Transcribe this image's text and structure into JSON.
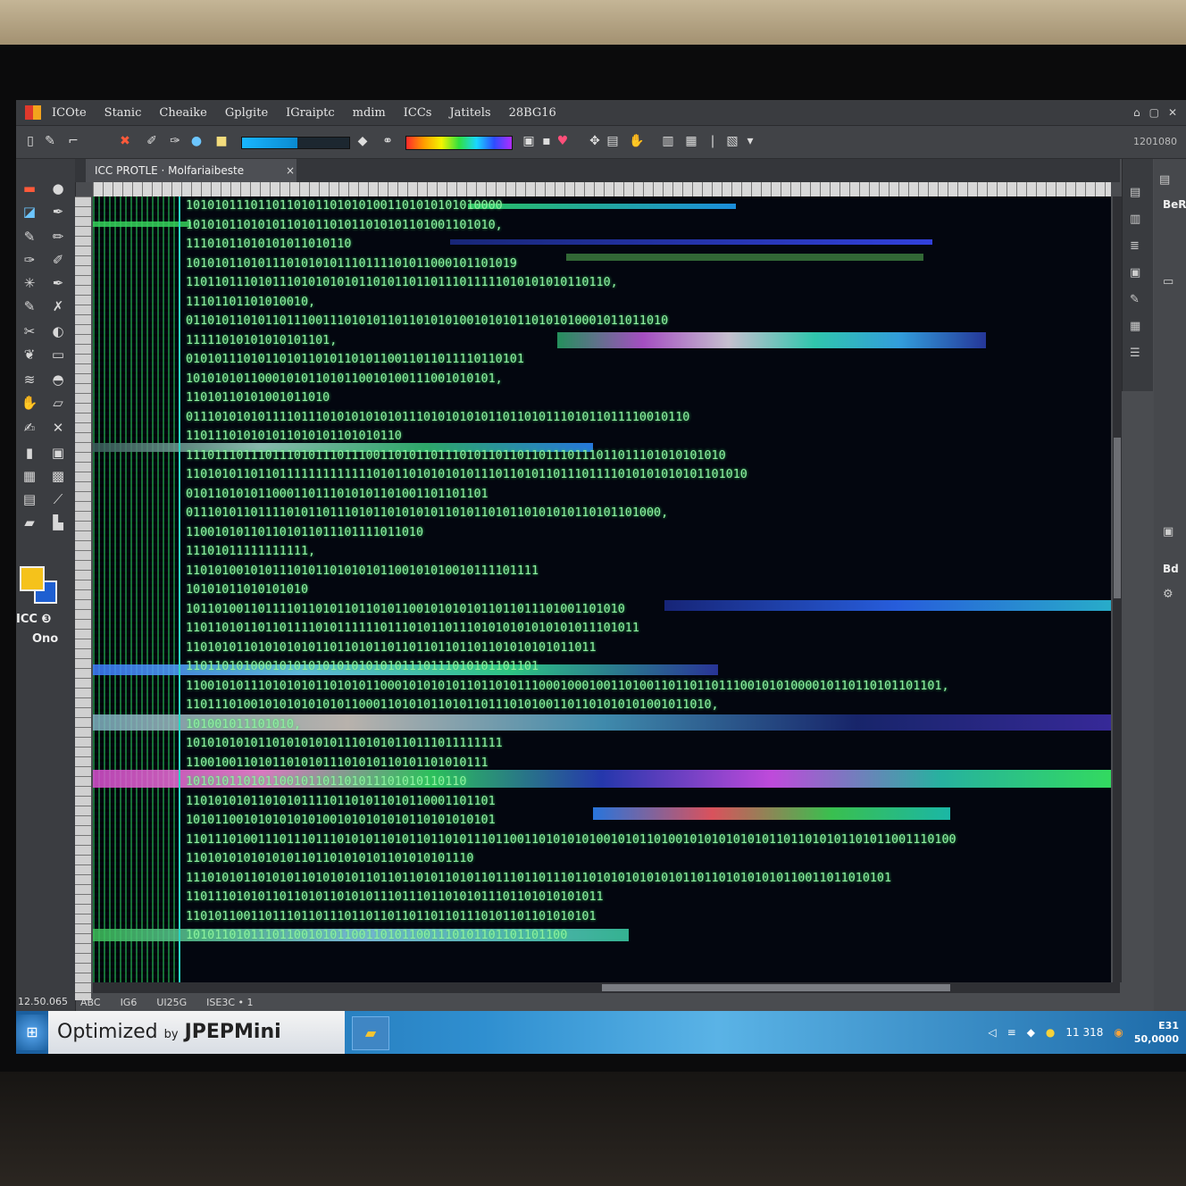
{
  "app": {
    "menu": [
      "ICOte",
      "Stanic",
      "Cheaike",
      "Gplgite",
      "IGraiptc",
      "mdim",
      "ICCs",
      "Jatitels",
      "28BG16"
    ]
  },
  "toolbar": {
    "progress_fraction": 0.52,
    "right_text": "1201080"
  },
  "document_tab": {
    "label": "ICC PROTLE · Molfariaibeste",
    "close_label": "×"
  },
  "tools_panel": {
    "label_line1": "ICC ❸",
    "label_line2": "Ono"
  },
  "right_panel": {
    "title1": "BeR",
    "title2": "Bd"
  },
  "canvas": {
    "code_lines": [
      "10101011101101101011010101001101010101010000",
      "1010101101010110101101011010101101001101010,",
      "11101011010101011010110",
      "1010101101011101010101110111101011000101101019",
      "11011011101011101010101011010110110111011111010101010110110,",
      "11101101101010010,",
      "0110101101011011100111010101101101010100101010110101010001011011010",
      "11111010101010101101,",
      "01010111010110101101011010110011011011110110101",
      "1010101011000101011010110010100111001010101,",
      "11010110101001011010",
      "0111010101011110111010101010101110101010101101101011101011011110010110",
      "110111010101011010101101010110",
      "111011101110111010111011100110101101110101101101101110111011011101010101010",
      "110101011011011111111111110101101010101011101101011011101111010101010101101010",
      "010110101011000110111010101101001101101101",
      "011101011011110101101110101101010101101011010110101010110101101000,",
      "110010101101101011011101111011010",
      "11101011111111111,",
      "1101010010101110101101010101100101010010111101111",
      "10101011010101010",
      "1011010011011110110101101101011001010101011011011101001101010",
      "110110101101101111010111111011101011011101010101010101011101011",
      "110101011010101010110110101101101101101101101010101011011",
      "1101101010001010101010101010101110111010101101101",
      "110010101110101010110101011000101010101101101011100010001001101001101101101110010101000010110110101101101,",
      "1101110100101010101010110001101010110101101110101001101101010101001011010,",
      "101001011101010,",
      "10101010101101010101011101010110111011111111",
      "110010011010110101011101010110101101010111",
      "101010110101100101101101011101010110110",
      "1101010101101010111101101011010110001101101",
      "1010110010101010101001010101010110101010101",
      "11011101001110111011101010110101101101011101100110101010100101011010010101010101011011010101101011001110100",
      "1101010101010101101101010101101010101110",
      "11101010110101011010101011011011010110101101110110111011010101010101011011010101010110011011010101",
      "1101110101011011010110101011101110110101011101101010101011",
      "110101100110111011011101101101101101101110101101101010101",
      "10101101011101100101011001101011001110101101101101100"
    ]
  },
  "status": {
    "zoom": "12.50.065",
    "items": [
      "ABC",
      "IG6",
      "UI25G",
      "ISE3C • 1"
    ]
  },
  "taskbar": {
    "banner_prefix": "Optimized",
    "banner_by": "by",
    "banner_brand": "JPEPMini",
    "tray_num": "11 318",
    "clock_top": "E31",
    "clock_bottom": "50,0000"
  },
  "colors": {
    "code_green": "#8ef0a0",
    "cursor_cyan": "#29d6c4",
    "fg_swatch": "#f5c21b",
    "bg_swatch": "#1e5fd1"
  }
}
